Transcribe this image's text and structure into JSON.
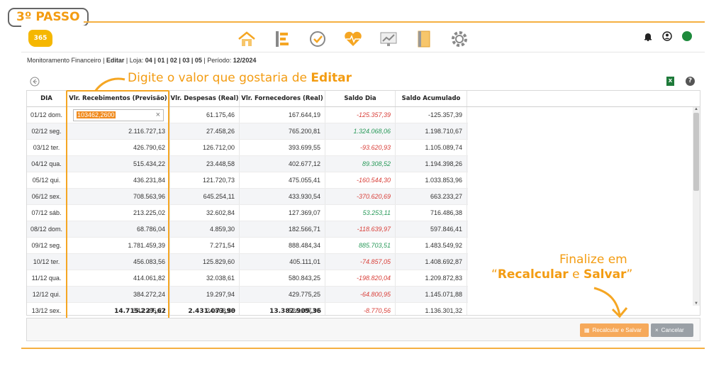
{
  "step_label": "3º PASSO",
  "breadcrumb": {
    "module": "Monitoramento Financeiro",
    "sep1": " | ",
    "action": "Editar",
    "sep2": " | Loja: ",
    "stores": "04 | 01 | 02 | 03 | 05",
    "sep3": " | Período: ",
    "period": "12/2024"
  },
  "annotations": {
    "edit_prefix": "Digite o valor que gostaria de ",
    "edit_bold": "Editar",
    "finalize_line1": "Finalize em",
    "finalize_q_open": "“",
    "finalize_recalc": "Recalcular",
    "finalize_and": " e ",
    "finalize_save": "Salvar",
    "finalize_q_close": "”"
  },
  "nav_icons": [
    "home-icon",
    "list-icon",
    "check-circle-icon",
    "heart-pulse-icon",
    "chart-icon",
    "notebook-icon",
    "gear-icon"
  ],
  "table": {
    "headers": [
      "DIA",
      "Vlr. Recebimentos (Previsão)",
      "Vlr. Despesas (Real)",
      "Vlr. Fornecedores (Real)",
      "Saldo Dia",
      "Saldo Acumulado"
    ],
    "editing_value": "103462,2600",
    "rows": [
      [
        "01/12 dom.",
        "",
        "61.175,46",
        "167.644,19",
        "-125.357,39",
        "-125.357,39"
      ],
      [
        "02/12 seg.",
        "2.116.727,13",
        "27.458,26",
        "765.200,81",
        "1.324.068,06",
        "1.198.710,67"
      ],
      [
        "03/12 ter.",
        "426.790,62",
        "126.712,00",
        "393.699,55",
        "-93.620,93",
        "1.105.089,74"
      ],
      [
        "04/12 qua.",
        "515.434,22",
        "23.448,58",
        "402.677,12",
        "89.308,52",
        "1.194.398,26"
      ],
      [
        "05/12 qui.",
        "436.231,84",
        "121.720,73",
        "475.055,41",
        "-160.544,30",
        "1.033.853,96"
      ],
      [
        "06/12 sex.",
        "708.563,96",
        "645.254,11",
        "433.930,54",
        "-370.620,69",
        "663.233,27"
      ],
      [
        "07/12 sáb.",
        "213.225,02",
        "32.602,84",
        "127.369,07",
        "53.253,11",
        "716.486,38"
      ],
      [
        "08/12 dom.",
        "68.786,04",
        "4.859,30",
        "182.566,71",
        "-118.639,97",
        "597.846,41"
      ],
      [
        "09/12 seg.",
        "1.781.459,39",
        "7.271,54",
        "888.484,34",
        "885.703,51",
        "1.483.549,92"
      ],
      [
        "10/12 ter.",
        "456.083,56",
        "125.829,60",
        "405.111,01",
        "-74.857,05",
        "1.408.692,87"
      ],
      [
        "11/12 qua.",
        "414.061,82",
        "32.038,61",
        "580.843,25",
        "-198.820,04",
        "1.209.872,83"
      ],
      [
        "12/12 qui.",
        "384.272,24",
        "19.297,94",
        "429.775,25",
        "-64.800,95",
        "1.145.071,88"
      ],
      [
        "13/12 sex.",
        "542.386,27",
        "24.868,88",
        "526.287,95",
        "-8.770,56",
        "1.136.301,32"
      ]
    ],
    "totals": [
      "",
      "14.715.227,62",
      "2.431.073,90",
      "13.382.909,36",
      "",
      ""
    ]
  },
  "buttons": {
    "save": "Recalcular e Salvar",
    "cancel": "Cancelar"
  },
  "excel_label": "X",
  "help_label": "?",
  "logo_text": "365",
  "colors": {
    "accent": "#f39c12",
    "negative": "#d9403a",
    "positive": "#2a9a5a",
    "status": "#1e8a3c"
  }
}
